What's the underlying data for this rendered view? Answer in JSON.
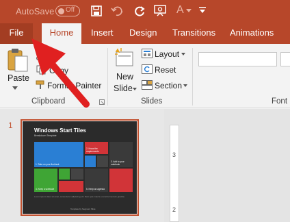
{
  "titlebar": {
    "autosave_label": "AutoSave",
    "autosave_state": "Off",
    "font_color_letter": "A"
  },
  "tabs": [
    {
      "label": "File"
    },
    {
      "label": "Home"
    },
    {
      "label": "Insert"
    },
    {
      "label": "Design"
    },
    {
      "label": "Transitions"
    },
    {
      "label": "Animations"
    }
  ],
  "ribbon": {
    "clipboard": {
      "paste_label": "Paste",
      "copy_label": "Copy",
      "format_painter_label": "Format Painter",
      "group_label": "Clipboard"
    },
    "slides": {
      "new_slide_line1": "New",
      "new_slide_line2": "Slide",
      "layout_label": "Layout",
      "reset_label": "Reset",
      "section_label": "Section",
      "group_label": "Slides"
    },
    "font": {
      "group_label": "Font"
    }
  },
  "slides_pane": {
    "slide_number": "1",
    "thumbnail": {
      "title": "Windows Start Tiles",
      "subtitle": "Breakdown Template",
      "tile_texts": [
        "1. Take on your first task",
        "2. Know the requirements",
        "3. Add to your notebook",
        "4. Keep a schedule",
        "5. Keep an agenda"
      ],
      "footer_text": "Lorem ipsum dolor sit amet, consectetur adipiscing elit. Nam quis mauris et erat fermentum gravida.",
      "credit": "Template by Segment Slide"
    }
  },
  "ruler": {
    "marks": [
      "3",
      "2"
    ]
  },
  "colors": {
    "accent": "#b7472a",
    "tile_red": "#d13438",
    "tile_green": "#3fa535",
    "tile_blue": "#2a7fd4",
    "arrow_red": "#e02020"
  }
}
